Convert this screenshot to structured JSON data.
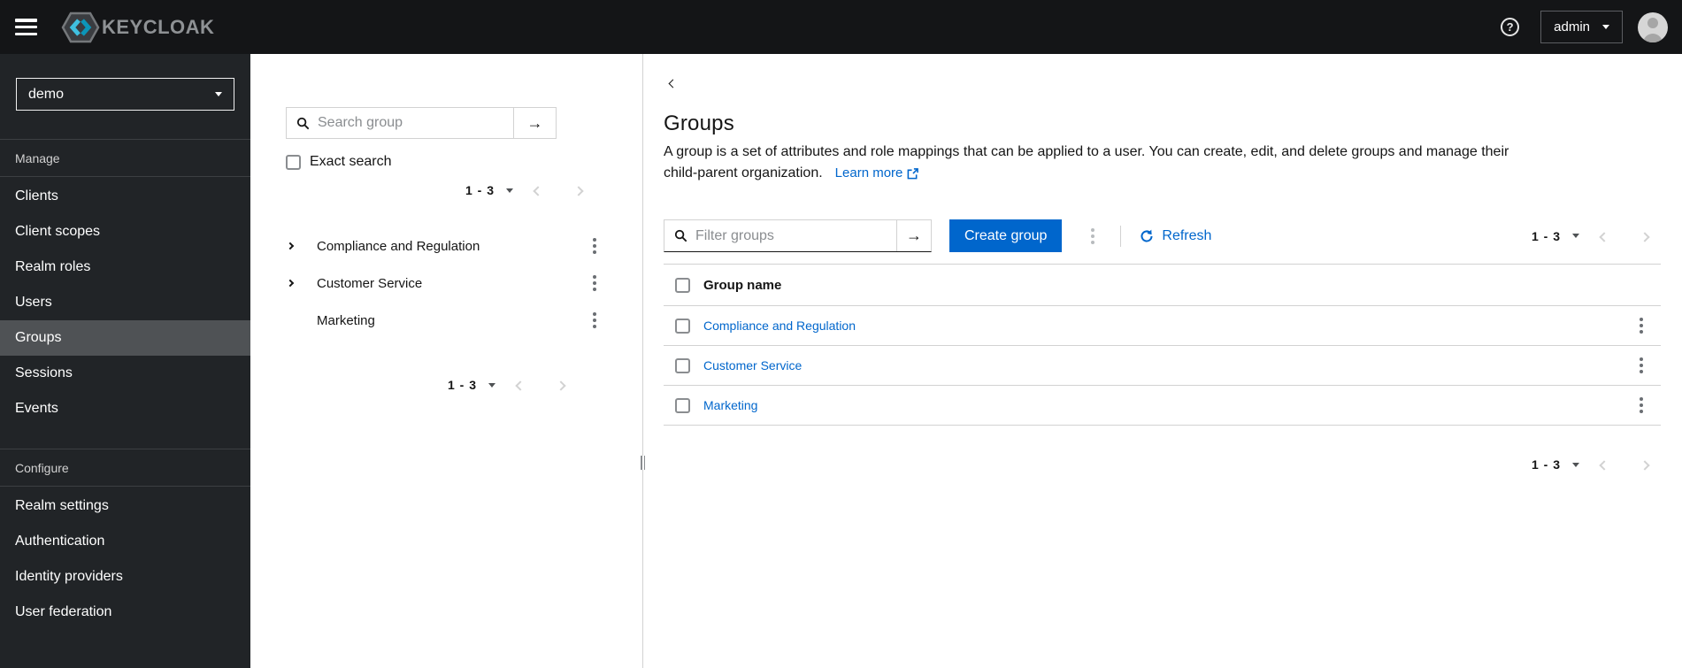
{
  "colors": {
    "accent": "#0066cc",
    "masthead_bg": "#141517",
    "sidebar_bg": "#212427",
    "sidebar_selected_bg": "#4f5255",
    "link": "#0066cc",
    "logo_cyan": "#3fc0e0",
    "logo_teal": "#0c95b8"
  },
  "masthead": {
    "brand": "KEYCLOAK",
    "username": "admin"
  },
  "sidebar": {
    "realm": "demo",
    "sections": [
      {
        "title": "Manage",
        "items": [
          {
            "label": "Clients"
          },
          {
            "label": "Client scopes"
          },
          {
            "label": "Realm roles"
          },
          {
            "label": "Users"
          },
          {
            "label": "Groups",
            "selected": true
          },
          {
            "label": "Sessions"
          },
          {
            "label": "Events"
          }
        ]
      },
      {
        "title": "Configure",
        "items": [
          {
            "label": "Realm settings"
          },
          {
            "label": "Authentication"
          },
          {
            "label": "Identity providers"
          },
          {
            "label": "User federation"
          }
        ]
      }
    ]
  },
  "tree_panel": {
    "search_placeholder": "Search group",
    "search_value": "",
    "exact_search_label": "Exact search",
    "exact_search_checked": false,
    "pagination_top": {
      "range": "1 - 3"
    },
    "groups": [
      {
        "name": "Compliance and Regulation",
        "expandable": true
      },
      {
        "name": "Customer Service",
        "expandable": true
      },
      {
        "name": "Marketing",
        "expandable": false
      }
    ],
    "pagination_bottom": {
      "range": "1 - 3"
    }
  },
  "main": {
    "title": "Groups",
    "description_line1": "A group is a set of attributes and role mappings that can be applied to a user. You can create, edit, and delete groups and manage their",
    "description_line2": "child-parent organization.",
    "learn_more_label": "Learn more",
    "toolbar": {
      "filter_placeholder": "Filter groups",
      "filter_value": "",
      "create_button_label": "Create group",
      "refresh_label": "Refresh",
      "pagination": {
        "range": "1 - 3"
      }
    },
    "table": {
      "column_header": "Group name",
      "rows": [
        {
          "name": "Compliance and Regulation"
        },
        {
          "name": "Customer Service"
        },
        {
          "name": "Marketing"
        }
      ]
    },
    "pagination_bottom": {
      "range": "1 - 3"
    }
  }
}
